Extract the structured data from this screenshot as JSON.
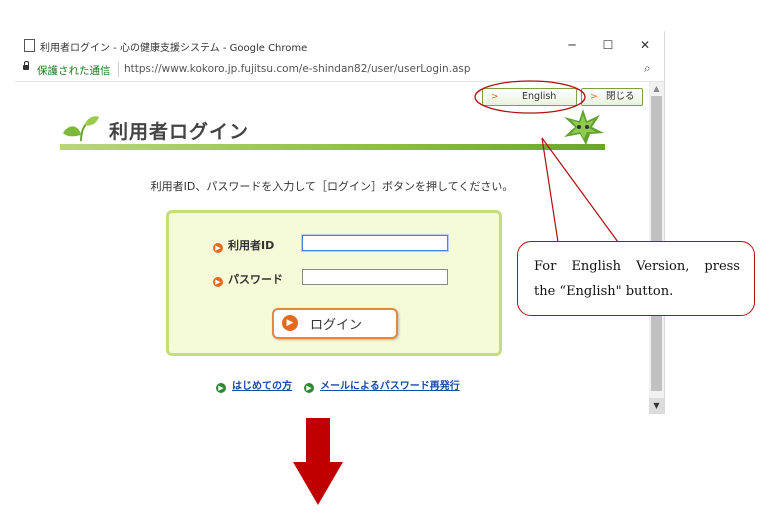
{
  "window": {
    "title": "利用者ログイン - 心の健康支援システム - Google Chrome",
    "controls": {
      "minimize": "─",
      "maximize": "☐",
      "close": "✕"
    }
  },
  "addressbar": {
    "security_label": "保護された通信",
    "url": "https://www.kokoro.jp.fujitsu.com/e-shindan82/user/userLogin.asp"
  },
  "top_buttons": {
    "english": "English",
    "close": "閉じる"
  },
  "page": {
    "heading": "利用者ログイン",
    "instruction": "利用者ID、パスワードを入力して［ログイン］ボタンを押してください。"
  },
  "form": {
    "user_id_label": "利用者ID",
    "user_id_value": "",
    "password_label": "パスワード",
    "password_value": "",
    "login_button": "ログイン"
  },
  "links": {
    "first_time": "はじめての方",
    "password_reissue": "メールによるパスワード再発行"
  },
  "callout": {
    "line1_words": [
      "For",
      "English",
      "Version,",
      "press"
    ],
    "line2": "the “English\" button."
  },
  "colors": {
    "accent_orange": "#e46a1e",
    "leaf_green": "#8dbf3a",
    "panel_bg": "#f5fad8",
    "callout_red": "#b01010",
    "arrow_red": "#c00000"
  }
}
